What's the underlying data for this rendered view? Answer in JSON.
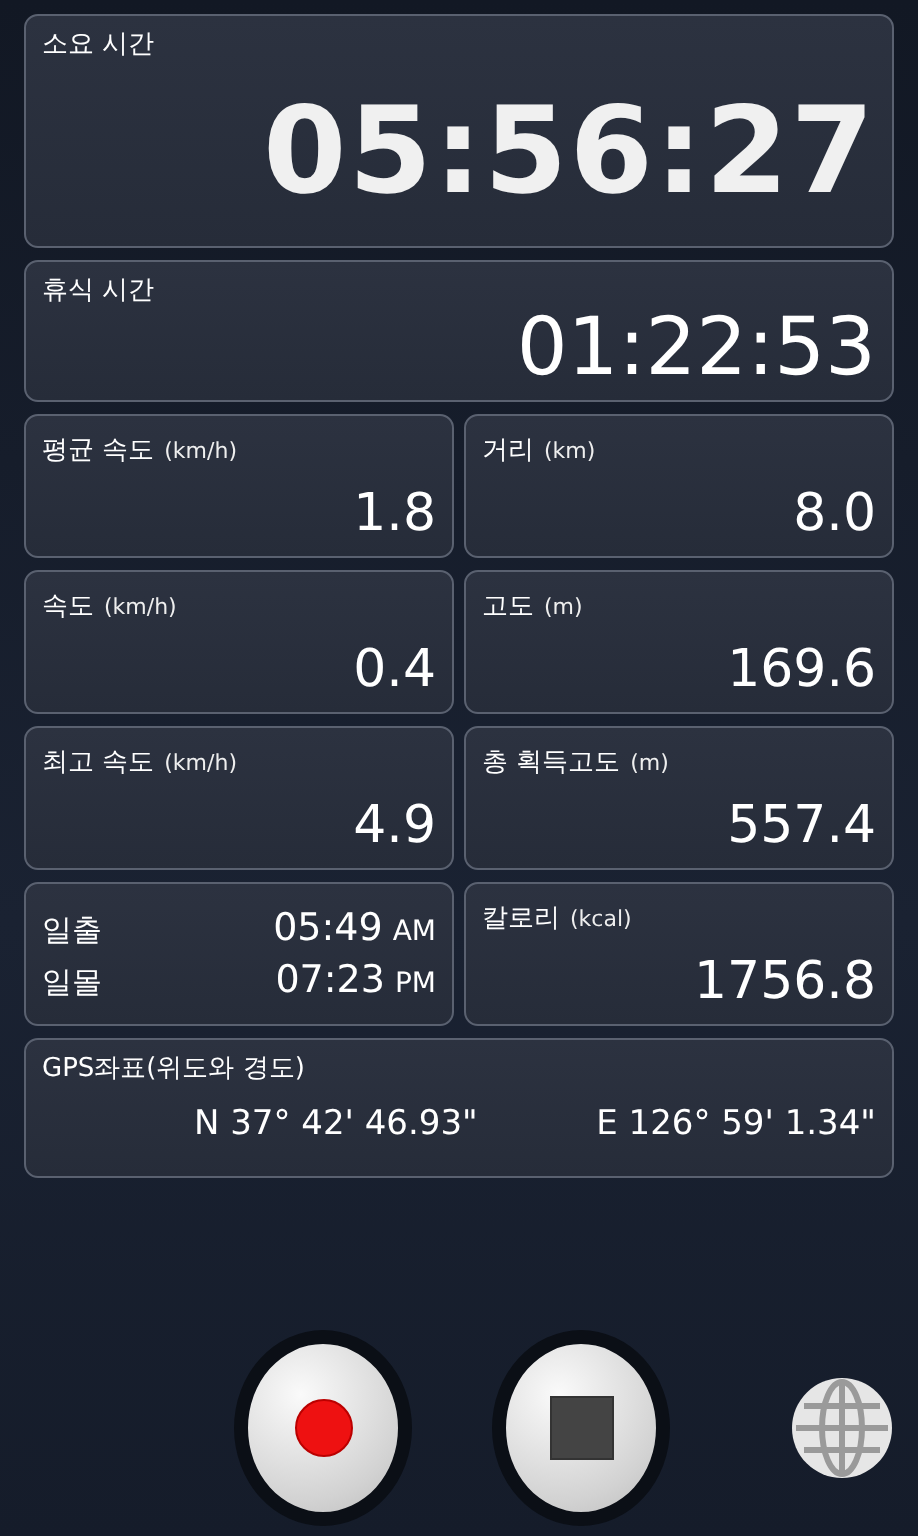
{
  "elapsed": {
    "label": "소요 시간",
    "value": "05:56:27"
  },
  "rest": {
    "label": "휴식 시간",
    "value": "01:22:53"
  },
  "cards": [
    {
      "kind": "stat",
      "label": "평균 속도",
      "unit": "(km/h)",
      "value": "1.8"
    },
    {
      "kind": "stat",
      "label": "거리",
      "unit": "(km)",
      "value": "8.0"
    },
    {
      "kind": "stat",
      "label": "속도",
      "unit": "(km/h)",
      "value": "0.4"
    },
    {
      "kind": "stat",
      "label": "고도",
      "unit": "(m)",
      "value": "169.6"
    },
    {
      "kind": "stat",
      "label": "최고 속도",
      "unit": "(km/h)",
      "value": "4.9"
    },
    {
      "kind": "stat",
      "label": "총 획득고도",
      "unit": "(m)",
      "value": "557.4"
    },
    {
      "kind": "sun",
      "rows": [
        {
          "label": "일출",
          "time": "05:49",
          "period": "AM"
        },
        {
          "label": "일몰",
          "time": "07:23",
          "period": "PM"
        }
      ]
    },
    {
      "kind": "stat",
      "label": "칼로리",
      "unit": "(kcal)",
      "value": "1756.8"
    }
  ],
  "gps": {
    "label": "GPS좌표(위도와 경도)",
    "latitude": "N 37° 42' 46.93\"",
    "longitude": "E 126° 59' 1.34\""
  }
}
